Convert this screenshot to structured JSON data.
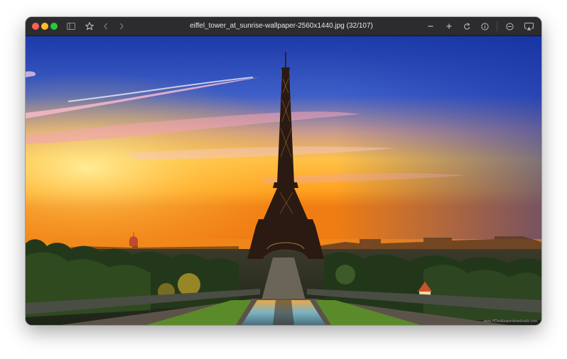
{
  "window": {
    "title": "eiffel_tower_at_sunrise-wallpaper-2560x1440.jpg (32/107)"
  },
  "toolbar": {
    "sidebar_icon": "sidebar-icon",
    "favorite_icon": "star-icon",
    "back_icon": "chevron-left-icon",
    "forward_icon": "chevron-right-icon",
    "zoom_out_icon": "minus-icon",
    "zoom_in_icon": "plus-icon",
    "rotate_icon": "rotate-icon",
    "info_icon": "info-icon",
    "actual_size_icon": "circle-minus-icon",
    "airplay_icon": "airplay-icon"
  },
  "image": {
    "subject": "Eiffel Tower at sunrise",
    "watermark": "www.HDwallpaperdownloads.com"
  },
  "colors": {
    "close": "#ff5f57",
    "minimize": "#febc2e",
    "maximize": "#28c840",
    "sky_top": "#1f3fb4",
    "sky_horizon": "#ffb12e"
  }
}
